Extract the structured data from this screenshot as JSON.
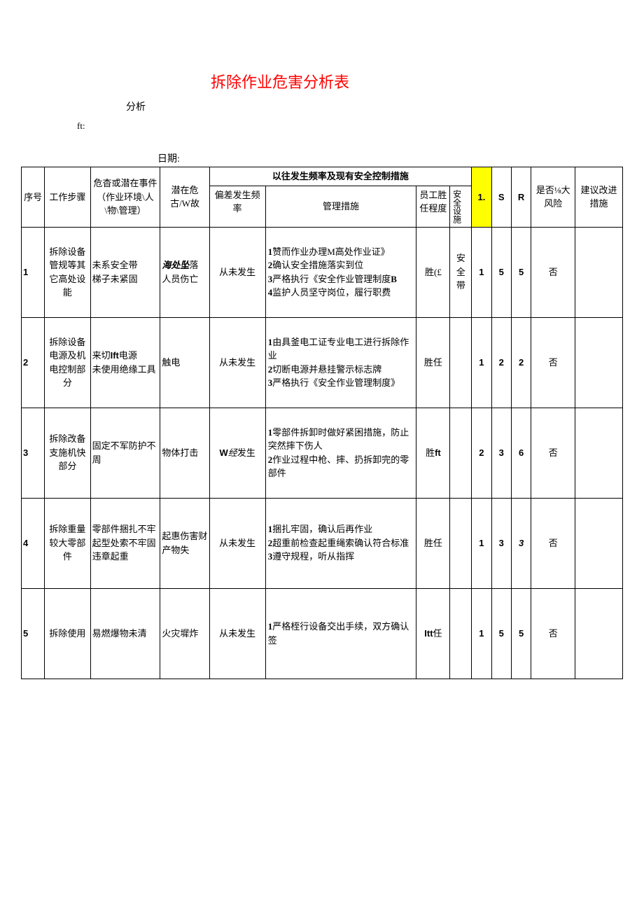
{
  "title": "拆除作业危害分析表",
  "labels": {
    "analysis": "分析",
    "ft": "ft:",
    "date": "日期:"
  },
  "headers": {
    "seq": "序号",
    "step": "工作步骤",
    "hazard": "危杳或潜在事件（作业环境\\人\\物\\管理）",
    "accident": "潜在危古/W故",
    "group": "以往发生频率及现有安全控制措施",
    "freq": "偏差发生频率",
    "mgmt": "管理措施",
    "comp": "员工胜任程度",
    "safe": "安全设施",
    "L": "1.",
    "S": "S",
    "R": "R",
    "big": "是否⅛大风险",
    "improve": "建议改进措施"
  },
  "rows": [
    {
      "seq": "1",
      "step": "拆除设备管规等其它高处设能",
      "hazard": "未系安全带\n梯子未紧固",
      "accident_html": "<span class=\"ital bold\">海处坠</span>落<br>人员伤亡",
      "freq": "从未发生",
      "mgmt_html": "<span class=\"bold\">1</span>赞而作业办理M高处作业证》<br><span class=\"bold\">2</span>确认安全措施落实到位<br><span class=\"bold\">3</span>严格执行《安全作业管理制度<span class=\"bold\">B</span><br><span class=\"bold\">4</span>监护人员坚守岗位，履行职费",
      "comp": "胜(£",
      "safe": "安全带",
      "L": "1",
      "S": "5",
      "R": "5",
      "big": "否",
      "improve": ""
    },
    {
      "seq": "2",
      "step": "拆除设备电源及机电控制部分",
      "hazard_html": "来切<span class=\"bold sans\">Ift</span>电源<br>未使用绝缘工具",
      "accident": "触电",
      "freq": "从未发生",
      "mgmt_html": "<span class=\"bold\">1</span>由具釜电工证专业电工进行拆除作业<br><span class=\"bold\">2</span>切断电源并悬挂警示标志牌<br><span class=\"bold\">3</span>严格执行《安全作业管理制度》",
      "comp": "胜任",
      "safe": "",
      "L": "1",
      "S": "2",
      "R": "2",
      "big": "否",
      "improve": ""
    },
    {
      "seq": "3",
      "step": "拆除改备支施机快部分",
      "hazard": "固定不军防护不周",
      "accident": "物体打击",
      "freq_html": "<span class=\"bold sans\">W</span><span class=\"ital\">经</span>发生",
      "mgmt_html": "<span class=\"bold\">1</span>零部件拆卸时做好紧困措施，防止突然摔下伤人<br><span class=\"bold\">2</span>作业过程中枪、摔、扔拆卸完的零部件",
      "comp_html": "胜<span class=\"bold sans\">ft</span>",
      "safe": "",
      "L": "2",
      "S": "3",
      "R": "6",
      "big": "否",
      "improve": ""
    },
    {
      "seq": "4",
      "step": "拆除重量较大零部件",
      "hazard": "零部件捆扎不牢起型处索不牢固\n违章起重",
      "accident": "起惠伤害财产物失",
      "freq": "从未发生",
      "mgmt_html": "<span class=\"bold\">1</span>捆扎牢固，确认后再作业<br><span class=\"bold\">2</span>超重前检查起重绳索确认符合标准<br><span class=\"bold\">3</span>遵守规程，听从指挥",
      "comp": "胜任",
      "safe": "",
      "L": "1",
      "S": "3",
      "R_html": "<span class=\"ital\">3</span>",
      "big": "否",
      "improve": ""
    },
    {
      "seq": "5",
      "step": "拆除使用",
      "hazard": "易燃爆物未清",
      "accident": "火灾墀炸",
      "freq": "从未发生",
      "mgmt_html": "<span class=\"bold\">1</span>严格桎行设备交出手续，双方确认签",
      "comp_html": "<span class=\"bold sans\">Itt</span>任",
      "safe": "",
      "L": "1",
      "S": "5",
      "R": "5",
      "big": "否",
      "improve": ""
    }
  ]
}
